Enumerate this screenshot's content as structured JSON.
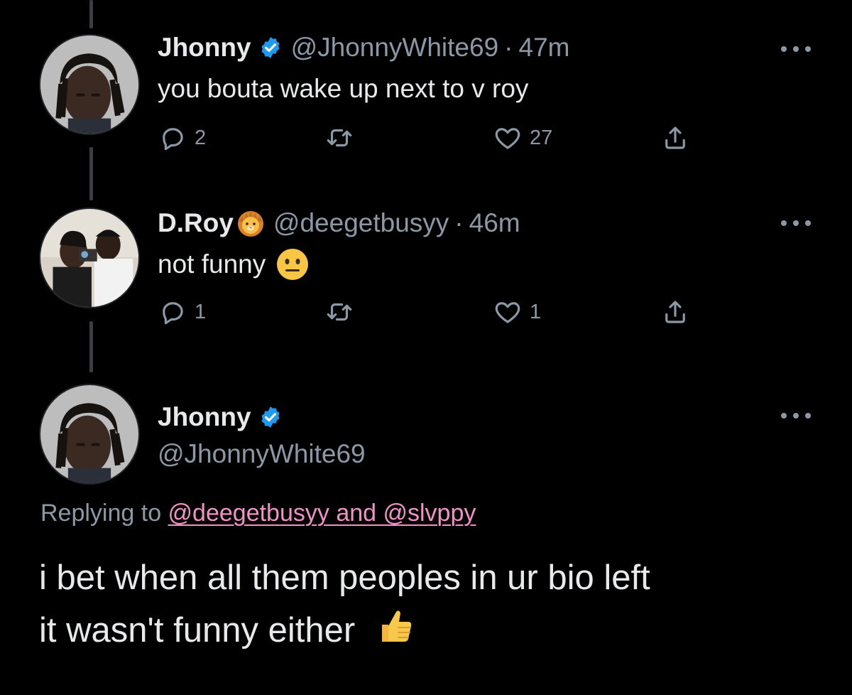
{
  "colors": {
    "background": "#000000",
    "text": "#e7e9ea",
    "secondary": "#8b98a5",
    "verified": "#1d9bf0",
    "mention": "#f291c7",
    "thread_line": "#3a3d41"
  },
  "tweets": [
    {
      "name": "Jhonny",
      "verified": true,
      "handle": "@JhonnyWhite69",
      "dot": "·",
      "time": "47m",
      "text": "you bouta wake up next to v roy",
      "replies": "2",
      "retweets": "",
      "likes": "27",
      "icons": [
        "reply-icon",
        "retweet-icon",
        "heart-icon",
        "share-icon"
      ]
    },
    {
      "name": "D.Roy",
      "badge_emoji": "lion-face",
      "handle": "@deegetbusyy",
      "dot": "·",
      "time": "46m",
      "text": "not funny",
      "text_emoji": "neutral-face",
      "replies": "1",
      "retweets": "",
      "likes": "1",
      "icons": [
        "reply-icon",
        "retweet-icon",
        "heart-icon",
        "share-icon"
      ]
    }
  ],
  "main_tweet": {
    "name": "Jhonny",
    "verified": true,
    "handle": "@JhonnyWhite69",
    "replying_prefix": "Replying to ",
    "replying_mentions": "@deegetbusyy and @slvppy",
    "text_line1": "i bet when all them peoples in ur bio left",
    "text_line2": "it wasn't funny either",
    "text_emoji": "thumbs-up"
  }
}
